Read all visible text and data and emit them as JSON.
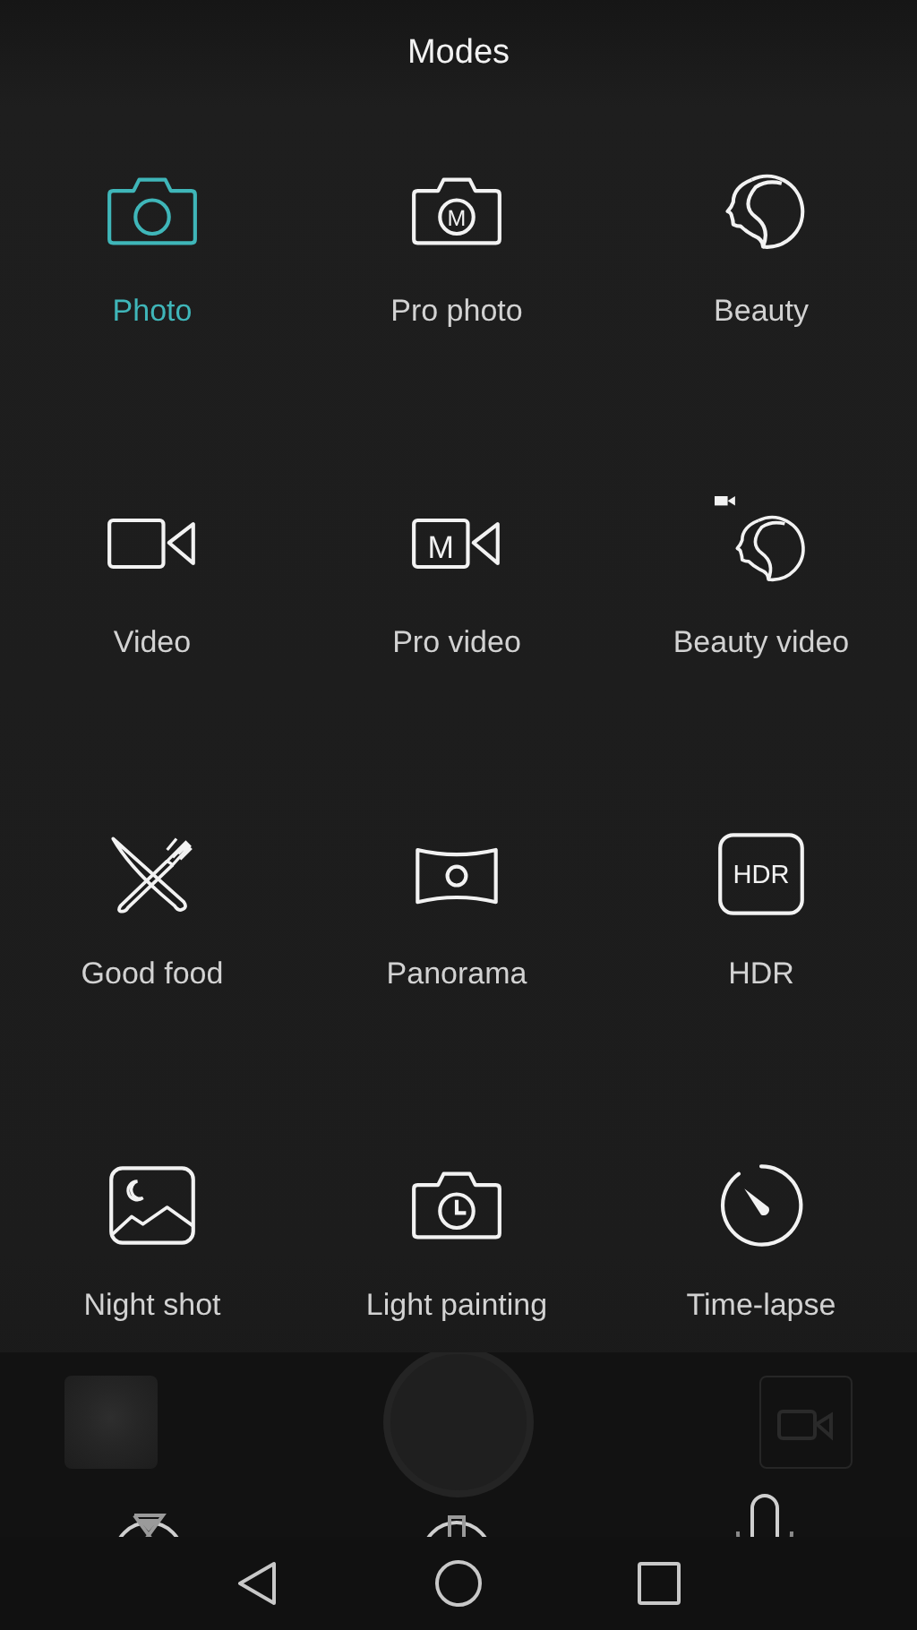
{
  "title": "Modes",
  "modes": [
    {
      "label": "Photo",
      "kind": "photo",
      "selected": true
    },
    {
      "label": "Pro photo",
      "kind": "pro-photo",
      "icon_text": "M",
      "selected": false
    },
    {
      "label": "Beauty",
      "kind": "beauty",
      "selected": false
    },
    {
      "label": "Video",
      "kind": "video",
      "selected": false
    },
    {
      "label": "Pro video",
      "kind": "pro-video",
      "icon_text": "M",
      "selected": false
    },
    {
      "label": "Beauty video",
      "kind": "beauty-video",
      "selected": false
    },
    {
      "label": "Good food",
      "kind": "food",
      "selected": false
    },
    {
      "label": "Panorama",
      "kind": "panorama",
      "selected": false
    },
    {
      "label": "HDR",
      "kind": "hdr",
      "icon_text": "HDR",
      "selected": false
    },
    {
      "label": "Night shot",
      "kind": "night",
      "selected": false
    },
    {
      "label": "Light painting",
      "kind": "light-painting",
      "selected": false
    },
    {
      "label": "Time-lapse",
      "kind": "timelapse",
      "selected": false
    }
  ]
}
